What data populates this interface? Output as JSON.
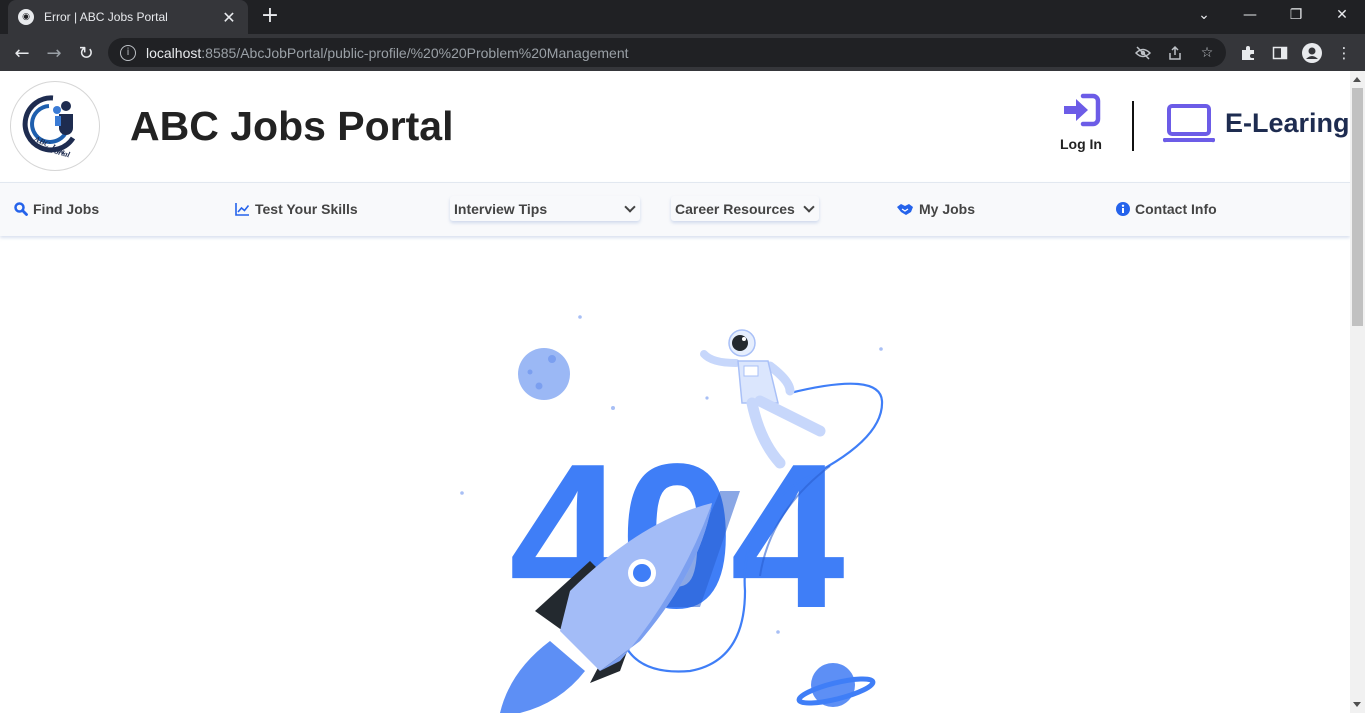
{
  "browser": {
    "tab_title": "Error | ABC Jobs Portal",
    "tab_close": "✕",
    "new_tab": "+",
    "url_host": "localhost",
    "url_path": ":8585/AbcJobPortal/public-profile/%20%20Problem%20Management",
    "icons": [
      "back-icon",
      "forward-icon",
      "reload-icon",
      "site-info-icon",
      "eye-off-icon",
      "share-icon",
      "star-icon",
      "extensions-icon",
      "side-panel-icon",
      "profile-icon",
      "menu-icon"
    ]
  },
  "header": {
    "title": "ABC Jobs Portal",
    "login_label": "Log In",
    "elearning_label": "E-Learing",
    "accent_color": "#6c5ce7"
  },
  "nav": {
    "find_jobs": "Find Jobs",
    "test_skills": "Test Your Skills",
    "interview_tips": "Interview Tips",
    "career_resources": "Career Resources",
    "my_jobs": "My Jobs",
    "contact_info": "Contact Info",
    "icon_color": "#2563eb"
  },
  "error": {
    "code": "404",
    "primary_color": "#3f7ef7"
  }
}
